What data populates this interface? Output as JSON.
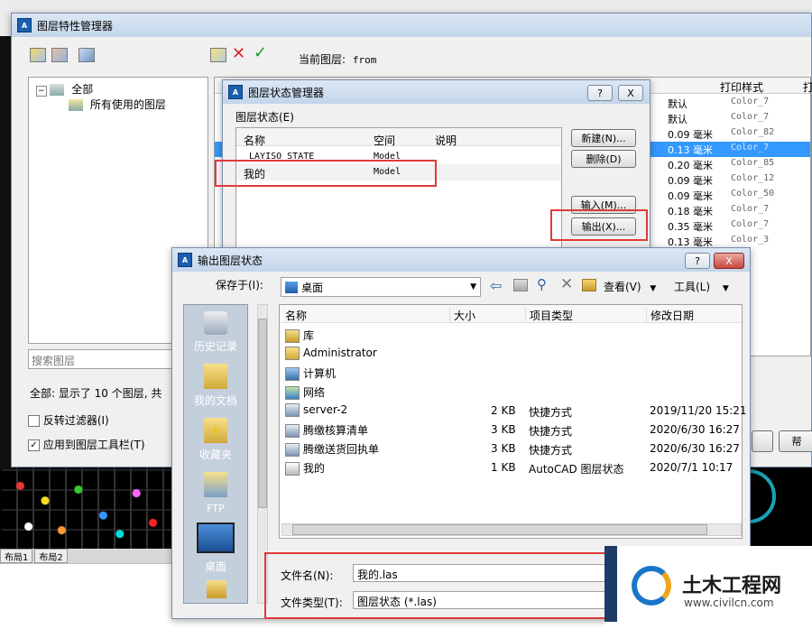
{
  "layer_manager": {
    "title": "图层特性管理器",
    "current_layer_label": "当前图层:",
    "current_layer_value": "from",
    "tree": {
      "root": "全部",
      "child": "所有使用的图层"
    },
    "search_placeholder": "搜索图层",
    "status_text": "全部: 显示了 10 个图层, 共",
    "invert_filter": "反转过滤器(I)",
    "apply_toolbar": "应用到图层工具栏(T)",
    "bottom_btn": "帮",
    "columns": {
      "lineweight": "",
      "print_style": "打印样式",
      "print": "打"
    },
    "rows": [
      {
        "lw": "默认",
        "ps": "Color_7"
      },
      {
        "lw": "默认",
        "ps": "Color_7"
      },
      {
        "lw": "0.09 毫米",
        "ps": "Color_82"
      },
      {
        "lw": "0.13 毫米",
        "ps": "Color_7",
        "selected": true
      },
      {
        "lw": "0.20 毫米",
        "ps": "Color_85"
      },
      {
        "lw": "0.09 毫米",
        "ps": "Color_12"
      },
      {
        "lw": "0.09 毫米",
        "ps": "Color_50"
      },
      {
        "lw": "0.18 毫米",
        "ps": "Color_7"
      },
      {
        "lw": "0.35 毫米",
        "ps": "Color_7"
      },
      {
        "lw": "0.13 毫米",
        "ps": "Color_3"
      }
    ],
    "layout_tabs": [
      "布局1",
      "布局2"
    ]
  },
  "state_manager": {
    "title": "图层状态管理器",
    "group_label": "图层状态(E)",
    "columns": {
      "name": "名称",
      "space": "空间",
      "desc": "说明"
    },
    "rows": [
      {
        "name": "_LAYISO_STATE",
        "space": "Model"
      },
      {
        "name": "我的",
        "space": "Model"
      }
    ],
    "buttons": {
      "new": "新建(N)...",
      "delete": "删除(D)",
      "import": "输入(M)...",
      "export": "输出(X)..."
    },
    "help_btn": "?",
    "close_btn": "X"
  },
  "export_dialog": {
    "title": "输出图层状态",
    "save_in_label": "保存于(I):",
    "save_in_value": "桌面",
    "view_menu": "查看(V)",
    "tools_menu": "工具(L)",
    "places": [
      "历史记录",
      "我的文档",
      "收藏夹",
      "FTP",
      "桌面"
    ],
    "columns": {
      "name": "名称",
      "size": "大小",
      "type": "项目类型",
      "date": "修改日期"
    },
    "files": [
      {
        "name": "库",
        "size": "",
        "type": "",
        "date": "",
        "icon": "library-icon"
      },
      {
        "name": "Administrator",
        "size": "",
        "type": "",
        "date": "",
        "icon": "user-folder-icon"
      },
      {
        "name": "计算机",
        "size": "",
        "type": "",
        "date": "",
        "icon": "computer-icon"
      },
      {
        "name": "网络",
        "size": "",
        "type": "",
        "date": "",
        "icon": "network-icon"
      },
      {
        "name": "server-2",
        "size": "2 KB",
        "type": "快捷方式",
        "date": "2019/11/20 15:21",
        "icon": "shortcut-icon"
      },
      {
        "name": "腾缴核算清单",
        "size": "3 KB",
        "type": "快捷方式",
        "date": "2020/6/30 16:27",
        "icon": "shortcut-icon"
      },
      {
        "name": "腾缴送货回执单",
        "size": "3 KB",
        "type": "快捷方式",
        "date": "2020/6/30 16:27",
        "icon": "shortcut-icon"
      },
      {
        "name": "我的",
        "size": "1 KB",
        "type": "AutoCAD 图层状态",
        "date": "2020/7/1 10:17",
        "icon": "las-file-icon"
      }
    ],
    "filename_label": "文件名(N):",
    "filename_value": "我的.las",
    "filetype_label": "文件类型(T):",
    "filetype_value": "图层状态 (*.las)",
    "help_btn": "?",
    "close_btn": "X"
  },
  "watermark": {
    "brand": "土木工程网",
    "url": "www.civilcn.com"
  }
}
